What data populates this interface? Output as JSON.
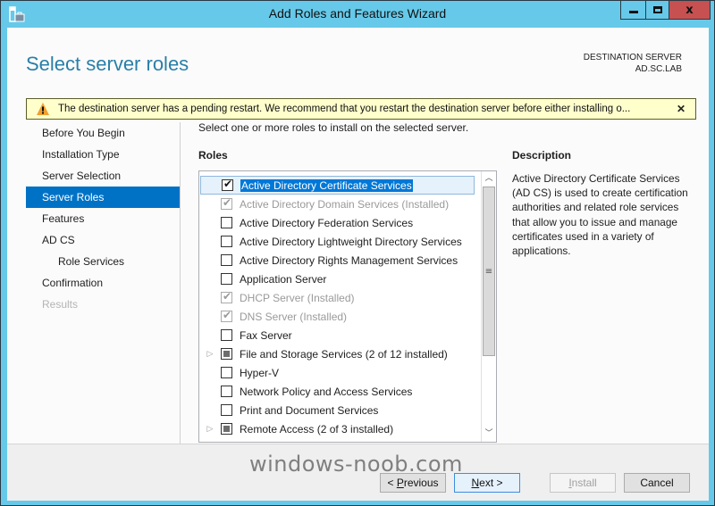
{
  "window": {
    "title": "Add Roles and Features Wizard",
    "controls": {
      "minimize": "minimize",
      "maximize": "maximize",
      "close": "x"
    }
  },
  "header": {
    "page_title": "Select server roles",
    "destination_label": "DESTINATION SERVER",
    "destination_server": "AD.SC.LAB"
  },
  "warning": {
    "text": "The destination server has a pending restart. We recommend that you restart the destination server before either installing o...",
    "close_glyph": "✕"
  },
  "nav": {
    "items": [
      {
        "label": "Before You Begin",
        "state": "normal"
      },
      {
        "label": "Installation Type",
        "state": "normal"
      },
      {
        "label": "Server Selection",
        "state": "normal"
      },
      {
        "label": "Server Roles",
        "state": "active"
      },
      {
        "label": "Features",
        "state": "normal"
      },
      {
        "label": "AD CS",
        "state": "normal"
      },
      {
        "label": "Role Services",
        "state": "sub"
      },
      {
        "label": "Confirmation",
        "state": "normal"
      },
      {
        "label": "Results",
        "state": "disabled"
      }
    ]
  },
  "main": {
    "instruction": "Select one or more roles to install on the selected server.",
    "roles_heading": "Roles",
    "roles": [
      {
        "label": "Active Directory Certificate Services",
        "check": "checked",
        "disabled": false,
        "expandable": false,
        "selected": true
      },
      {
        "label": "Active Directory Domain Services (Installed)",
        "check": "checked",
        "disabled": true,
        "expandable": false,
        "selected": false
      },
      {
        "label": "Active Directory Federation Services",
        "check": "unchecked",
        "disabled": false,
        "expandable": false,
        "selected": false
      },
      {
        "label": "Active Directory Lightweight Directory Services",
        "check": "unchecked",
        "disabled": false,
        "expandable": false,
        "selected": false
      },
      {
        "label": "Active Directory Rights Management Services",
        "check": "unchecked",
        "disabled": false,
        "expandable": false,
        "selected": false
      },
      {
        "label": "Application Server",
        "check": "unchecked",
        "disabled": false,
        "expandable": false,
        "selected": false
      },
      {
        "label": "DHCP Server (Installed)",
        "check": "checked",
        "disabled": true,
        "expandable": false,
        "selected": false
      },
      {
        "label": "DNS Server (Installed)",
        "check": "checked",
        "disabled": true,
        "expandable": false,
        "selected": false
      },
      {
        "label": "Fax Server",
        "check": "unchecked",
        "disabled": false,
        "expandable": false,
        "selected": false
      },
      {
        "label": "File and Storage Services (2 of 12 installed)",
        "check": "partial",
        "disabled": false,
        "expandable": true,
        "selected": false
      },
      {
        "label": "Hyper-V",
        "check": "unchecked",
        "disabled": false,
        "expandable": false,
        "selected": false
      },
      {
        "label": "Network Policy and Access Services",
        "check": "unchecked",
        "disabled": false,
        "expandable": false,
        "selected": false
      },
      {
        "label": "Print and Document Services",
        "check": "unchecked",
        "disabled": false,
        "expandable": false,
        "selected": false
      },
      {
        "label": "Remote Access (2 of 3 installed)",
        "check": "partial",
        "disabled": false,
        "expandable": true,
        "selected": false
      }
    ],
    "description_heading": "Description",
    "description": "Active Directory Certificate Services (AD CS) is used to create certification authorities and related role services that allow you to issue and manage certificates used in a variety of applications."
  },
  "footer": {
    "previous_prefix": "< ",
    "previous_accel": "P",
    "previous_rest": "revious",
    "next_accel": "N",
    "next_rest": "ext >",
    "install_accel": "I",
    "install_rest": "nstall",
    "cancel": "Cancel"
  },
  "watermark": "windows-noob.com",
  "colors": {
    "titlebar": "#66c9e9",
    "close_button": "#c75050",
    "nav_active": "#0072c6",
    "page_title": "#2a7fa8",
    "warning_bg": "#ffffcc",
    "selection_highlight": "#0078d7"
  }
}
